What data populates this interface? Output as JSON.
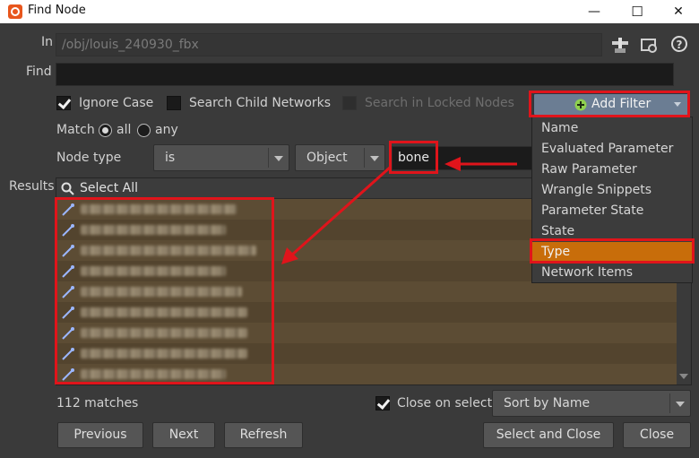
{
  "window": {
    "title": "Find Node",
    "minimize": "—",
    "maximize": "☐",
    "close": "✕"
  },
  "in_field": {
    "label": "In",
    "value": "/obj/louis_240930_fbx"
  },
  "find_field": {
    "label": "Find",
    "value": ""
  },
  "options": {
    "ignore_case": {
      "label": "Ignore Case",
      "checked": true
    },
    "search_child_networks": {
      "label": "Search Child Networks",
      "checked": false
    },
    "search_locked_nodes": {
      "label": "Search in Locked Nodes",
      "checked": false
    }
  },
  "add_filter": {
    "label": "Add Filter"
  },
  "match": {
    "label": "Match",
    "options": [
      "all",
      "any"
    ],
    "selected": "all"
  },
  "node_type": {
    "label": "Node type",
    "operator": "is",
    "category": "Object",
    "value": "bone"
  },
  "results": {
    "label": "Results",
    "select_all": "Select All",
    "row_count_shown": 9
  },
  "filter_menu": {
    "items": [
      "Name",
      "Evaluated Parameter",
      "Raw Parameter",
      "Wrangle Snippets",
      "Parameter State",
      "State",
      "Type",
      "Network Items"
    ],
    "selected": "Type"
  },
  "footer": {
    "matches": "112 matches",
    "close_on_select": {
      "label": "Close on select",
      "checked": true
    },
    "sort": "Sort by Name"
  },
  "buttons": {
    "previous": "Previous",
    "next": "Next",
    "refresh": "Refresh",
    "select_and_close": "Select and Close",
    "close": "Close"
  },
  "colors": {
    "accent_orange": "#c86d0a",
    "highlight_red": "#e0141b",
    "row_brown": "#5c4c34"
  }
}
